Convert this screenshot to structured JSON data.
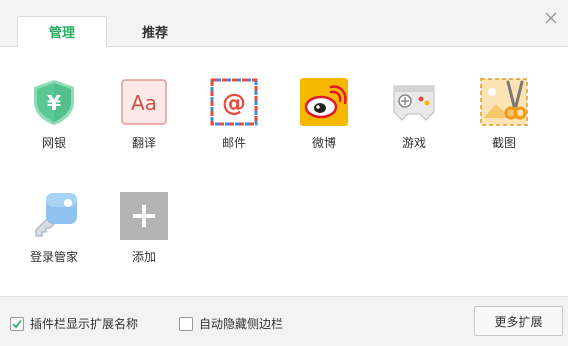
{
  "tabs": {
    "manage": "管理",
    "recommend": "推荐"
  },
  "extensions": [
    {
      "label": "网银",
      "icon": "bank-shield-icon"
    },
    {
      "label": "翻译",
      "icon": "translate-icon"
    },
    {
      "label": "邮件",
      "icon": "mail-icon"
    },
    {
      "label": "微博",
      "icon": "weibo-icon"
    },
    {
      "label": "游戏",
      "icon": "gamepad-icon"
    },
    {
      "label": "截图",
      "icon": "screenshot-scissors-icon"
    },
    {
      "label": "登录管家",
      "icon": "login-key-icon"
    },
    {
      "label": "添加",
      "icon": "add-icon"
    }
  ],
  "translate_glyph": "Aa",
  "bank_glyph": "¥",
  "mail_glyph": "@",
  "footer": {
    "show_names_label": "插件栏显示扩展名称",
    "show_names_checked": true,
    "auto_hide_label": "自动隐藏侧边栏",
    "auto_hide_checked": false,
    "more_button": "更多扩展"
  },
  "colors": {
    "accent": "#2cad62"
  }
}
